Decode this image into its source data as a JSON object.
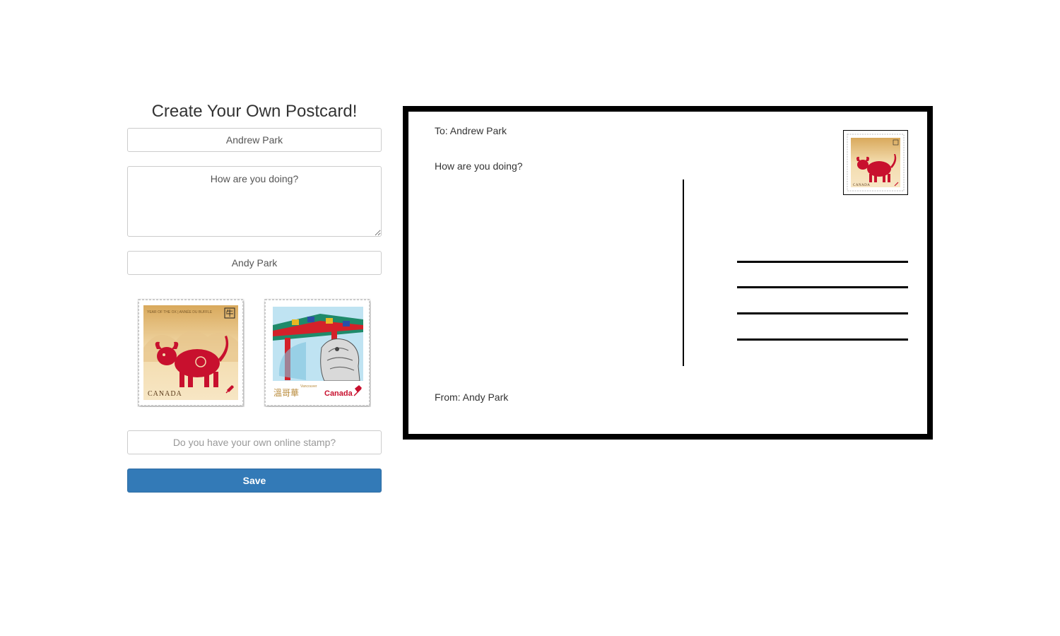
{
  "form": {
    "title": "Create Your Own Postcard!",
    "to_value": "Andrew Park",
    "message_value": "How are you doing?",
    "from_value": "Andy Park",
    "stamp_url_placeholder": "Do you have your own online stamp?",
    "save_label": "Save",
    "stamps": [
      {
        "country": "CANADA",
        "header": "YEAR OF THE OX | ANNÉE DU BUFFLE",
        "glyph": "牛",
        "icon": "ox-stamp-icon"
      },
      {
        "country": "Canada",
        "city": "Vancouver",
        "city_chinese": "溫哥華",
        "icon": "vancouver-gate-stamp-icon"
      }
    ]
  },
  "postcard": {
    "to_line": "To: Andrew Park",
    "message": "How are you doing?",
    "from_line": "From: Andy Park",
    "stamp_country": "CANADA",
    "stamp_icon": "ox-stamp-icon"
  },
  "colors": {
    "primary_button": "#337ab7",
    "postcard_border": "#000000",
    "stamp_red": "#c8102e",
    "stamp_gold": "#e8c88a"
  }
}
